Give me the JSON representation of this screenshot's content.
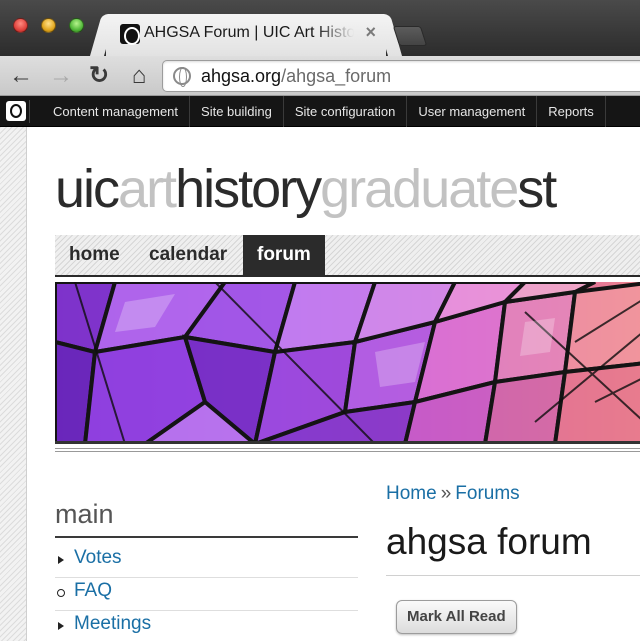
{
  "browser": {
    "tab_title": "AHGSA Forum | UIC Art History Graduate Student Association",
    "tab_close": "×",
    "url_host": "ahgsa.org",
    "url_path": "/ahgsa_forum"
  },
  "admin_bar": {
    "items": [
      "Content management",
      "Site building",
      "Site configuration",
      "User management",
      "Reports"
    ]
  },
  "site": {
    "title_parts": [
      "uic",
      "art",
      "history",
      "graduate",
      "st"
    ]
  },
  "nav": {
    "home": "home",
    "calendar": "calendar",
    "forum": "forum",
    "active": "forum"
  },
  "sidebar": {
    "heading": "main",
    "items": [
      {
        "label": "Votes",
        "bullet": "arrow"
      },
      {
        "label": "FAQ",
        "bullet": "circle"
      },
      {
        "label": "Meetings",
        "bullet": "arrow"
      }
    ]
  },
  "main": {
    "breadcrumb": [
      "Home",
      "Forums"
    ],
    "breadcrumb_sep": "»",
    "title": "ahgsa forum",
    "mark_all_read": "Mark All Read"
  },
  "colors": {
    "link": "#1a6fa5",
    "nav_active_bg": "#2b2b2b",
    "admin_bg": "#151515"
  },
  "icons": [
    "back-arrow-icon",
    "forward-arrow-icon",
    "reload-icon",
    "home-icon",
    "globe-icon",
    "drupal-logo-icon"
  ]
}
